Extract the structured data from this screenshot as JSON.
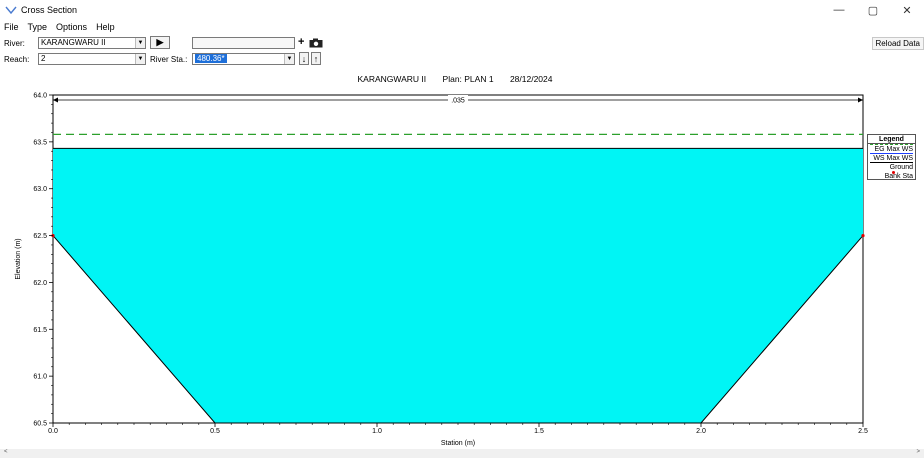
{
  "window": {
    "title": "Cross Section",
    "minimize": "—",
    "maximize": "▢",
    "close": "✕"
  },
  "menu": [
    "File",
    "Type",
    "Options",
    "Help"
  ],
  "toolbar": {
    "river_label": "River:",
    "river_value": "KARANGWARU II",
    "reach_label": "Reach:",
    "reach_value": "2",
    "river_sta_label": "River Sta.:",
    "river_sta_value": "480.36*",
    "play_glyph": "▶",
    "add_glyph": "+",
    "down_glyph": "↓",
    "up_glyph": "↑",
    "reload_label": "Reload Data"
  },
  "plot_title": {
    "river": "KARANGWARU II",
    "plan": "Plan: PLAN 1",
    "date": "28/12/2024"
  },
  "legend": {
    "title": "Legend",
    "items": [
      {
        "label": "EG Max WS",
        "color": "#2ca02c",
        "style": "dashed"
      },
      {
        "label": "WS Max WS",
        "color": "#1f3fff",
        "style": "solid"
      },
      {
        "label": "Ground",
        "color": "#000000",
        "style": "line-dot"
      },
      {
        "label": "Bank Sta",
        "color": "#e00000",
        "style": "dot"
      }
    ]
  },
  "chart_data": {
    "type": "area",
    "xlabel": "Station (m)",
    "ylabel": "Elevation (m)",
    "xlim": [
      0,
      2.5
    ],
    "ylim": [
      60.5,
      64.0
    ],
    "x_ticks": [
      "0.0",
      "0.5",
      "1.0",
      "1.5",
      "2.0",
      "2.5"
    ],
    "y_ticks": [
      "60.5",
      "61.0",
      "61.5",
      "62.0",
      "62.5",
      "63.0",
      "63.5",
      "64.0"
    ],
    "ground": [
      {
        "x": 0.0,
        "y": 62.5
      },
      {
        "x": 0.5,
        "y": 60.5
      },
      {
        "x": 2.0,
        "y": 60.5
      },
      {
        "x": 2.5,
        "y": 62.5
      }
    ],
    "bank_stations": [
      {
        "x": 0.0,
        "y": 62.5
      },
      {
        "x": 2.5,
        "y": 62.5
      }
    ],
    "eg_max_ws": 63.58,
    "ws_max_ws": 63.43,
    "mannings_n": ".035",
    "water_color": "#00f5f5",
    "eg_color": "#2ca02c",
    "ws_color": "#1f3fff",
    "bank_color": "#e00000"
  },
  "scroll": {
    "left": "<",
    "right": ">"
  }
}
